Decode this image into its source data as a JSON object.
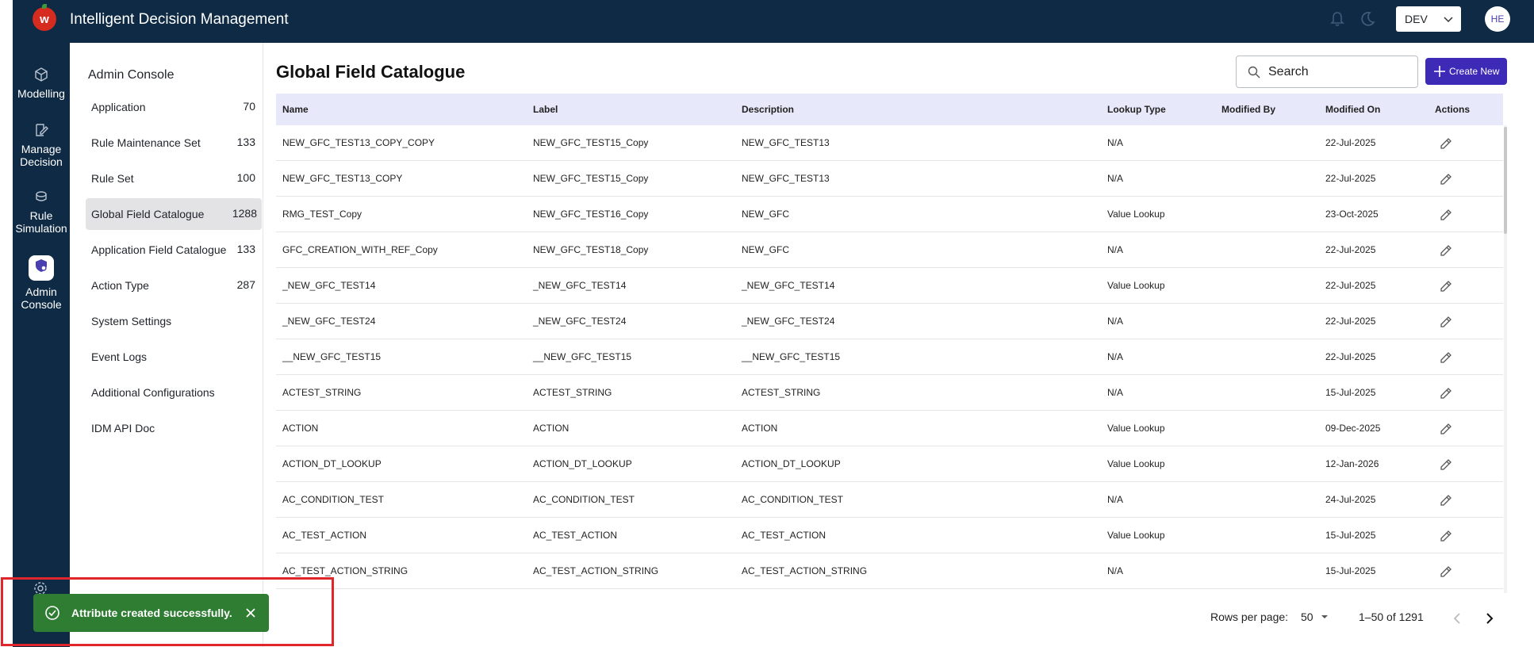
{
  "header": {
    "app_title": "Intelligent Decision Management",
    "logo_letter": "w",
    "environment": "DEV",
    "avatar_initials": "HE"
  },
  "rail": {
    "items": [
      {
        "label_1": "Modelling",
        "label_2": ""
      },
      {
        "label_1": "Manage",
        "label_2": "Decision"
      },
      {
        "label_1": "Rule",
        "label_2": "Simulation"
      },
      {
        "label_1": "Admin",
        "label_2": "Console"
      }
    ]
  },
  "subnav": {
    "title": "Admin Console",
    "items": [
      {
        "label": "Application",
        "count": "70"
      },
      {
        "label": "Rule Maintenance Set",
        "count": "133"
      },
      {
        "label": "Rule Set",
        "count": "100"
      },
      {
        "label": "Global Field Catalogue",
        "count": "1288"
      },
      {
        "label": "Application Field Catalogue",
        "count": "133"
      },
      {
        "label": "Action Type",
        "count": "287"
      },
      {
        "label": "System Settings",
        "count": ""
      },
      {
        "label": "Event Logs",
        "count": ""
      },
      {
        "label": "Additional Configurations",
        "count": ""
      },
      {
        "label": "IDM API Doc",
        "count": ""
      }
    ]
  },
  "main": {
    "title": "Global Field Catalogue",
    "search_placeholder": "Search",
    "create_label": "Create New",
    "columns": [
      "Name",
      "Label",
      "Description",
      "Lookup Type",
      "Modified By",
      "Modified On",
      "Actions"
    ],
    "rows": [
      {
        "name": "NEW_GFC_TEST13_COPY_COPY",
        "label": "NEW_GFC_TEST15_Copy",
        "description": "NEW_GFC_TEST13",
        "lookup": "N/A",
        "modified_by": "",
        "modified_on": "22-Jul-2025"
      },
      {
        "name": "NEW_GFC_TEST13_COPY",
        "label": "NEW_GFC_TEST15_Copy",
        "description": "NEW_GFC_TEST13",
        "lookup": "N/A",
        "modified_by": "",
        "modified_on": "22-Jul-2025"
      },
      {
        "name": "RMG_TEST_Copy",
        "label": "NEW_GFC_TEST16_Copy",
        "description": "NEW_GFC",
        "lookup": "Value Lookup",
        "modified_by": "",
        "modified_on": "23-Oct-2025"
      },
      {
        "name": "GFC_CREATION_WITH_REF_Copy",
        "label": "NEW_GFC_TEST18_Copy",
        "description": "NEW_GFC",
        "lookup": "N/A",
        "modified_by": "",
        "modified_on": "22-Jul-2025"
      },
      {
        "name": "_NEW_GFC_TEST14",
        "label": "_NEW_GFC_TEST14",
        "description": "_NEW_GFC_TEST14",
        "lookup": "Value Lookup",
        "modified_by": "",
        "modified_on": "22-Jul-2025"
      },
      {
        "name": "_NEW_GFC_TEST24",
        "label": "_NEW_GFC_TEST24",
        "description": "_NEW_GFC_TEST24",
        "lookup": "N/A",
        "modified_by": "",
        "modified_on": "22-Jul-2025"
      },
      {
        "name": "__NEW_GFC_TEST15",
        "label": "__NEW_GFC_TEST15",
        "description": "__NEW_GFC_TEST15",
        "lookup": "N/A",
        "modified_by": "",
        "modified_on": "22-Jul-2025"
      },
      {
        "name": "ACTEST_STRING",
        "label": "ACTEST_STRING",
        "description": "ACTEST_STRING",
        "lookup": "N/A",
        "modified_by": "",
        "modified_on": "15-Jul-2025"
      },
      {
        "name": "ACTION",
        "label": "ACTION",
        "description": "ACTION",
        "lookup": "Value Lookup",
        "modified_by": "",
        "modified_on": "09-Dec-2025"
      },
      {
        "name": "ACTION_DT_LOOKUP",
        "label": "ACTION_DT_LOOKUP",
        "description": "ACTION_DT_LOOKUP",
        "lookup": "Value Lookup",
        "modified_by": "",
        "modified_on": "12-Jan-2026"
      },
      {
        "name": "AC_CONDITION_TEST",
        "label": "AC_CONDITION_TEST",
        "description": "AC_CONDITION_TEST",
        "lookup": "N/A",
        "modified_by": "",
        "modified_on": "24-Jul-2025"
      },
      {
        "name": "AC_TEST_ACTION",
        "label": "AC_TEST_ACTION",
        "description": "AC_TEST_ACTION",
        "lookup": "Value Lookup",
        "modified_by": "",
        "modified_on": "15-Jul-2025"
      },
      {
        "name": "AC_TEST_ACTION_STRING",
        "label": "AC_TEST_ACTION_STRING",
        "description": "AC_TEST_ACTION_STRING",
        "lookup": "N/A",
        "modified_by": "",
        "modified_on": "15-Jul-2025"
      }
    ]
  },
  "pagination": {
    "rows_per_page_label": "Rows per page:",
    "rows_per_page": "50",
    "range": "1–50 of 1291"
  },
  "toast": {
    "message": "Attribute created successfully."
  },
  "colors": {
    "navy": "#0f2a44",
    "accent": "#3d2bb8",
    "header_row": "#e8e8fb",
    "toast_green": "#2e7d32",
    "highlight_red": "#e0252b"
  }
}
